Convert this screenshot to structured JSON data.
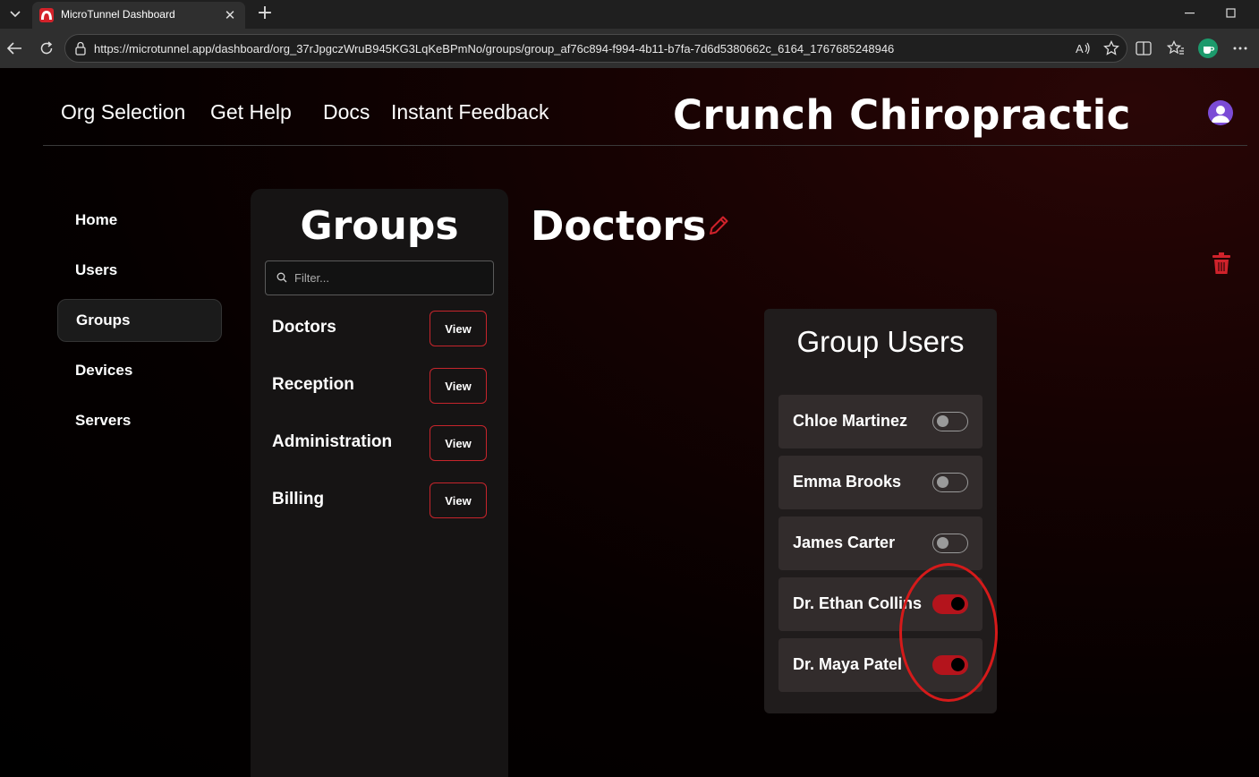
{
  "browser": {
    "tab_title": "MicroTunnel Dashboard",
    "url": "https://microtunnel.app/dashboard/org_37rJpgczWruB945KG3LqKeBPmNo/groups/group_af76c894-f994-4b11-b7fa-7d6d5380662c_6164_1767685248946"
  },
  "nav": {
    "links": [
      "Org Selection",
      "Get Help",
      "Docs",
      "Instant Feedback"
    ],
    "brand": "Crunch Chiropractic"
  },
  "sidebar": {
    "items": [
      "Home",
      "Users",
      "Groups",
      "Devices",
      "Servers"
    ],
    "active": "Groups"
  },
  "groups": {
    "title": "Groups",
    "filter_placeholder": "Filter...",
    "items": [
      {
        "name": "Doctors",
        "action": "View"
      },
      {
        "name": "Reception",
        "action": "View"
      },
      {
        "name": "Administration",
        "action": "View"
      },
      {
        "name": "Billing",
        "action": "View"
      }
    ]
  },
  "detail": {
    "title": "Doctors"
  },
  "group_users": {
    "title": "Group Users",
    "users": [
      {
        "name": "Chloe Martinez",
        "enabled": false
      },
      {
        "name": "Emma Brooks",
        "enabled": false
      },
      {
        "name": "James Carter",
        "enabled": false
      },
      {
        "name": "Dr. Ethan Collins",
        "enabled": true
      },
      {
        "name": "Dr. Maya Patel",
        "enabled": true
      }
    ]
  },
  "colors": {
    "accent": "#c6252c",
    "toggle_on": "#b4141c",
    "annotation": "#d51a1a",
    "avatar": "#7b4bd6"
  }
}
